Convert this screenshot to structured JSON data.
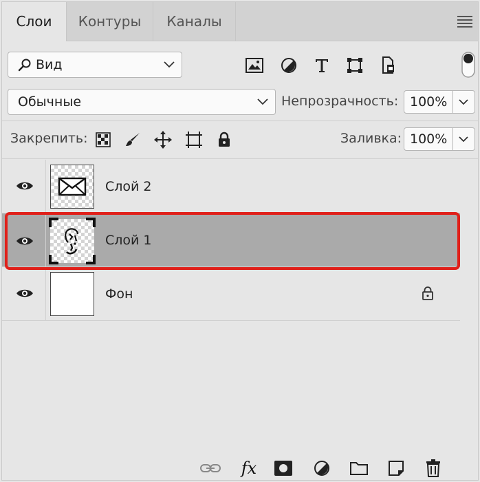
{
  "tabs": [
    {
      "label": "Слои",
      "active": true
    },
    {
      "label": "Контуры",
      "active": false
    },
    {
      "label": "Каналы",
      "active": false
    }
  ],
  "filter": {
    "label": "Вид",
    "icon": "search-icon"
  },
  "filter_icons": [
    "image-filter-icon",
    "adjustment-filter-icon",
    "type-filter-icon",
    "shape-filter-icon",
    "smart-object-filter-icon"
  ],
  "blend_mode": {
    "value": "Обычные"
  },
  "opacity": {
    "label": "Непрозрачность:",
    "value": "100%"
  },
  "lock": {
    "label": "Закрепить:",
    "icons": [
      "lock-transparent-pixels-icon",
      "lock-image-pixels-icon",
      "lock-position-icon",
      "lock-artboard-icon",
      "lock-all-icon"
    ]
  },
  "fill": {
    "label": "Заливка:",
    "value": "100%"
  },
  "layers": [
    {
      "name": "Слой 2",
      "visible": true,
      "thumb": "envelope",
      "selected": false,
      "locked": false
    },
    {
      "name": "Слой 1",
      "visible": true,
      "thumb": "sketch",
      "selected": true,
      "locked": false
    },
    {
      "name": "Фон",
      "visible": true,
      "thumb": "white",
      "selected": false,
      "locked": true
    }
  ],
  "bottom_icons": [
    "link-layers-icon",
    "fx-icon",
    "add-mask-icon",
    "adjustment-layer-icon",
    "group-folder-icon",
    "new-layer-icon",
    "delete-icon"
  ],
  "colors": {
    "highlight": "#e0201a",
    "selected_row": "#aaaaaa"
  }
}
